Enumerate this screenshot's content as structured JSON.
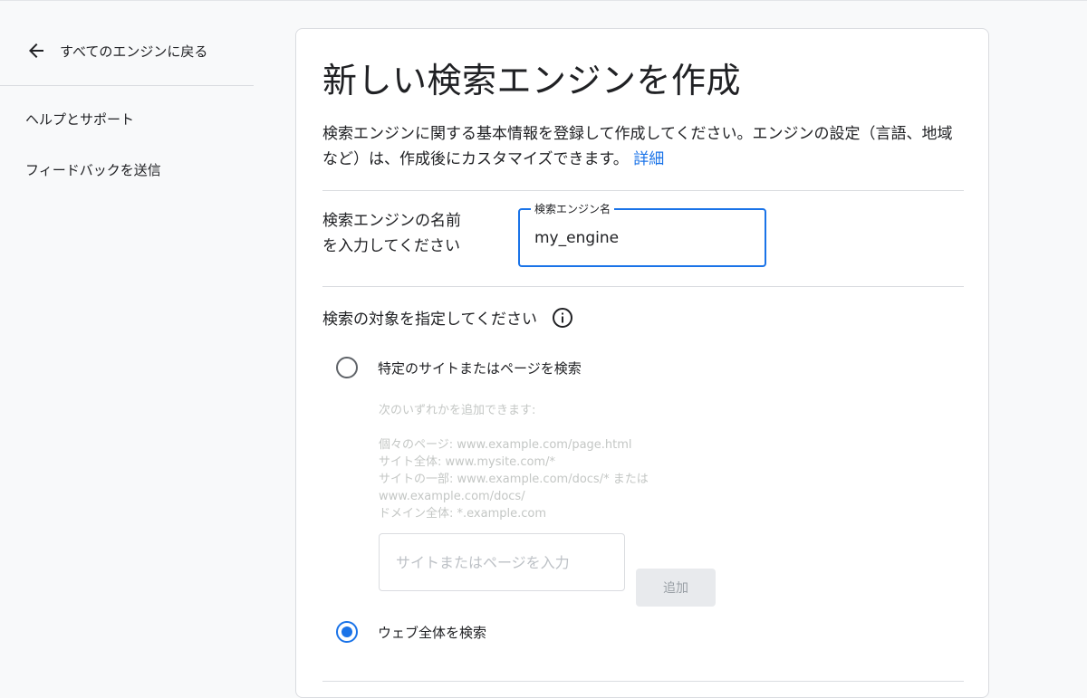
{
  "sidebar": {
    "back_label": "すべてのエンジンに戻る",
    "help_label": "ヘルプとサポート",
    "feedback_label": "フィードバックを送信"
  },
  "main": {
    "title": "新しい検索エンジンを作成",
    "description": "検索エンジンに関する基本情報を登録して作成してください。エンジンの設定（言語、地域など）は、作成後にカスタマイズできます。",
    "details_link": "詳細",
    "name_section": {
      "label_line1": "検索エンジンの名前",
      "label_line2": "を入力してください",
      "field_legend": "検索エンジン名",
      "field_value": "my_engine"
    },
    "target_section": {
      "heading": "検索の対象を指定してください",
      "info_icon": "info-icon",
      "option_specific": {
        "label": "特定のサイトまたはページを検索",
        "selected": false
      },
      "hint_lines": [
        "次のいずれかを追加できます:",
        "個々のページ: www.example.com/page.html",
        "サイト全体: www.mysite.com/*",
        "サイトの一部: www.example.com/docs/* または",
        "www.example.com/docs/",
        "ドメイン全体: *.example.com"
      ],
      "site_input_placeholder": "サイトまたはページを入力",
      "add_button_label": "追加",
      "option_web": {
        "label": "ウェブ全体を検索",
        "selected": true
      }
    }
  },
  "colors": {
    "accent": "#1a73e8",
    "background": "#f8f9fa",
    "card": "#ffffff",
    "divider": "#dadce0",
    "hint_text": "#c4c7c5",
    "disabled_button": "#e8eaed"
  }
}
